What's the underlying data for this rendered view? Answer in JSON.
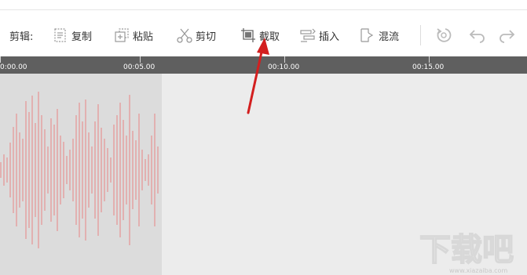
{
  "toolbar": {
    "label": "剪辑:",
    "buttons": [
      {
        "key": "copy",
        "label": "复制",
        "icon": "copy-icon"
      },
      {
        "key": "paste",
        "label": "粘贴",
        "icon": "paste-icon"
      },
      {
        "key": "cut",
        "label": "剪切",
        "icon": "scissors-icon"
      },
      {
        "key": "crop",
        "label": "截取",
        "icon": "crop-icon"
      },
      {
        "key": "insert",
        "label": "插入",
        "icon": "insert-icon"
      },
      {
        "key": "mix",
        "label": "混流",
        "icon": "mix-icon"
      }
    ],
    "history_icons": [
      "reset-icon",
      "undo-icon",
      "redo-icon"
    ]
  },
  "timeline": {
    "labels": [
      "0:00.00",
      "00:05.00",
      "00:10.00",
      "00:15.00"
    ]
  },
  "waveform": {
    "color": "#e4a6a6",
    "selection_color": "#dcdcdc",
    "track_color": "#ececec"
  },
  "annotation": {
    "arrow_color": "#d31f1f"
  },
  "watermark": {
    "text": "下载吧",
    "url": "www.xiazaiba.com"
  }
}
